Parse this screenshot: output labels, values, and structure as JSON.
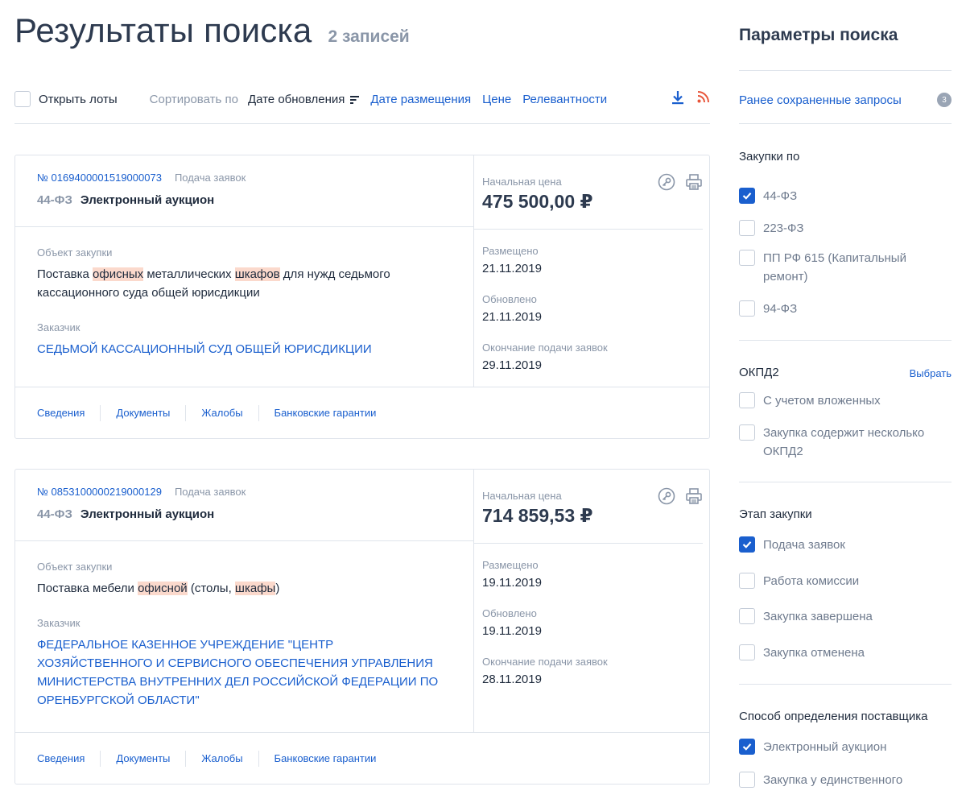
{
  "header": {
    "title": "Результаты поиска",
    "count": "2 записей"
  },
  "toolbar": {
    "open_lots": "Открыть лоты",
    "sort_label": "Сортировать по",
    "sort_active": "Дате обновления",
    "sort_options": [
      "Дате размещения",
      "Цене",
      "Релевантности"
    ]
  },
  "cards": [
    {
      "number": "№ 0169400001519000073",
      "stage": "Подача заявок",
      "law": "44-ФЗ",
      "procurement_type": "Электронный аукцион",
      "subject_label": "Объект закупки",
      "subject_parts": [
        {
          "text": "Поставка ",
          "hl": false
        },
        {
          "text": "офисных",
          "hl": true
        },
        {
          "text": " металлических ",
          "hl": false
        },
        {
          "text": "шкафов",
          "hl": true
        },
        {
          "text": " для нужд седьмого кассационного суда общей юрисдикции",
          "hl": false
        }
      ],
      "customer_label": "Заказчик",
      "customer": "СЕДЬМОЙ КАССАЦИОННЫЙ СУД ОБЩЕЙ ЮРИСДИКЦИИ",
      "price_label": "Начальная цена",
      "price": "475 500,00 ₽",
      "dates": [
        {
          "label": "Размещено",
          "value": "21.11.2019"
        },
        {
          "label": "Обновлено",
          "value": "21.11.2019"
        },
        {
          "label": "Окончание подачи заявок",
          "value": "29.11.2019"
        }
      ],
      "footer_links": [
        "Сведения",
        "Документы",
        "Жалобы",
        "Банковские гарантии"
      ]
    },
    {
      "number": "№ 0853100000219000129",
      "stage": "Подача заявок",
      "law": "44-ФЗ",
      "procurement_type": "Электронный аукцион",
      "subject_label": "Объект закупки",
      "subject_parts": [
        {
          "text": "Поставка мебели ",
          "hl": false
        },
        {
          "text": "офисной",
          "hl": true
        },
        {
          "text": " (столы, ",
          "hl": false
        },
        {
          "text": "шкафы",
          "hl": true
        },
        {
          "text": ")",
          "hl": false
        }
      ],
      "customer_label": "Заказчик",
      "customer": "ФЕДЕРАЛЬНОЕ КАЗЕННОЕ УЧРЕЖДЕНИЕ \"ЦЕНТР ХОЗЯЙСТВЕННОГО И СЕРВИСНОГО ОБЕСПЕЧЕНИЯ УПРАВЛЕНИЯ МИНИСТЕРСТВА ВНУТРЕННИХ ДЕЛ РОССИЙСКОЙ ФЕДЕРАЦИИ ПО ОРЕНБУРГСКОЙ ОБЛАСТИ\"",
      "price_label": "Начальная цена",
      "price": "714 859,53 ₽",
      "dates": [
        {
          "label": "Размещено",
          "value": "19.11.2019"
        },
        {
          "label": "Обновлено",
          "value": "19.11.2019"
        },
        {
          "label": "Окончание подачи заявок",
          "value": "28.11.2019"
        }
      ],
      "footer_links": [
        "Сведения",
        "Документы",
        "Жалобы",
        "Банковские гарантии"
      ]
    }
  ],
  "sidebar": {
    "title": "Параметры поиска",
    "saved_queries": "Ранее сохраненные запросы",
    "saved_count": "3",
    "purchases_by": {
      "title": "Закупки по",
      "options": [
        {
          "label": "44-ФЗ",
          "checked": true
        },
        {
          "label": "223-ФЗ",
          "checked": false
        },
        {
          "label": "ПП РФ 615 (Капитальный ремонт)",
          "checked": false
        },
        {
          "label": "94-ФЗ",
          "checked": false
        }
      ]
    },
    "okpd2": {
      "title": "ОКПД2",
      "choose": "Выбрать",
      "options": [
        {
          "label": "С учетом вложенных",
          "checked": false
        },
        {
          "label": "Закупка содержит несколько ОКПД2",
          "checked": false
        }
      ]
    },
    "stage": {
      "title": "Этап закупки",
      "options": [
        {
          "label": "Подача заявок",
          "checked": true
        },
        {
          "label": "Работа комиссии",
          "checked": false
        },
        {
          "label": "Закупка завершена",
          "checked": false
        },
        {
          "label": "Закупка отменена",
          "checked": false
        }
      ]
    },
    "supplier_method": {
      "title": "Способ определения поставщика",
      "options": [
        {
          "label": "Электронный аукцион",
          "checked": true
        },
        {
          "label": "Закупка у единственного",
          "checked": false
        }
      ]
    }
  },
  "colors": {
    "accent": "#1a5fce",
    "highlight": "#fbd9cc",
    "rss": "#e8553a",
    "muted": "#8a96a8"
  }
}
